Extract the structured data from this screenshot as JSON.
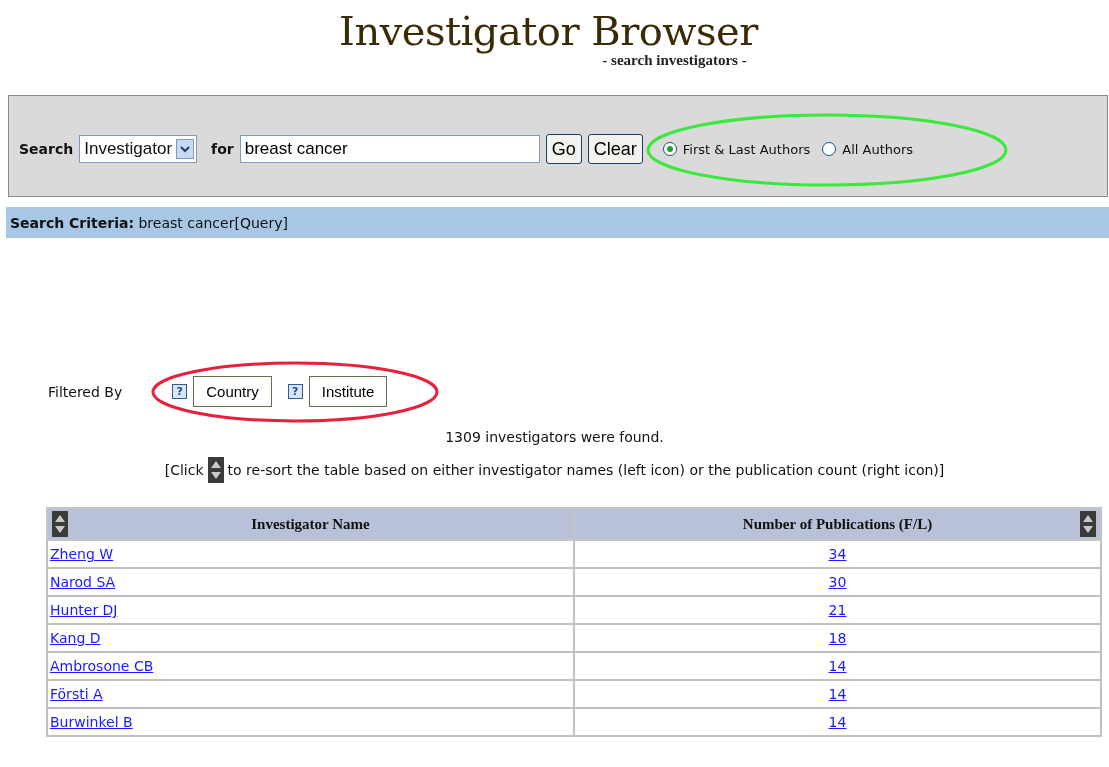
{
  "title": "Investigator Browser",
  "subtitle": "- search investigators -",
  "search": {
    "label": "Search",
    "field": {
      "value": "Investigator"
    },
    "for_label": "for",
    "query": {
      "value": "breast cancer"
    },
    "buttons": [
      "Go",
      "Clear"
    ],
    "author_options": [
      {
        "label": "First & Last Authors",
        "selected": true
      },
      {
        "label": "All Authors",
        "selected": false
      }
    ]
  },
  "criteria": {
    "label": "Search Criteria:",
    "value": "breast cancer[Query]"
  },
  "filters": {
    "label": "Filtered By",
    "items": [
      {
        "help": "?",
        "label": "Country"
      },
      {
        "help": "?",
        "label": "Institute"
      }
    ]
  },
  "result_count": "1309 investigators were found.",
  "sort_hint": {
    "before": "[Click",
    "after": "to re-sort the table based on either investigator names (left icon) or the publication count (right icon)]"
  },
  "table": {
    "columns": [
      "Investigator Name",
      "Number of Publications (F/L)"
    ],
    "rows": [
      {
        "name": "Zheng W",
        "count": "34"
      },
      {
        "name": "Narod SA",
        "count": "30"
      },
      {
        "name": "Hunter DJ",
        "count": "21"
      },
      {
        "name": "Kang D",
        "count": "18"
      },
      {
        "name": "Ambrosone CB",
        "count": "14"
      },
      {
        "name": "Försti A",
        "count": "14"
      },
      {
        "name": "Burwinkel B",
        "count": "14"
      }
    ]
  }
}
